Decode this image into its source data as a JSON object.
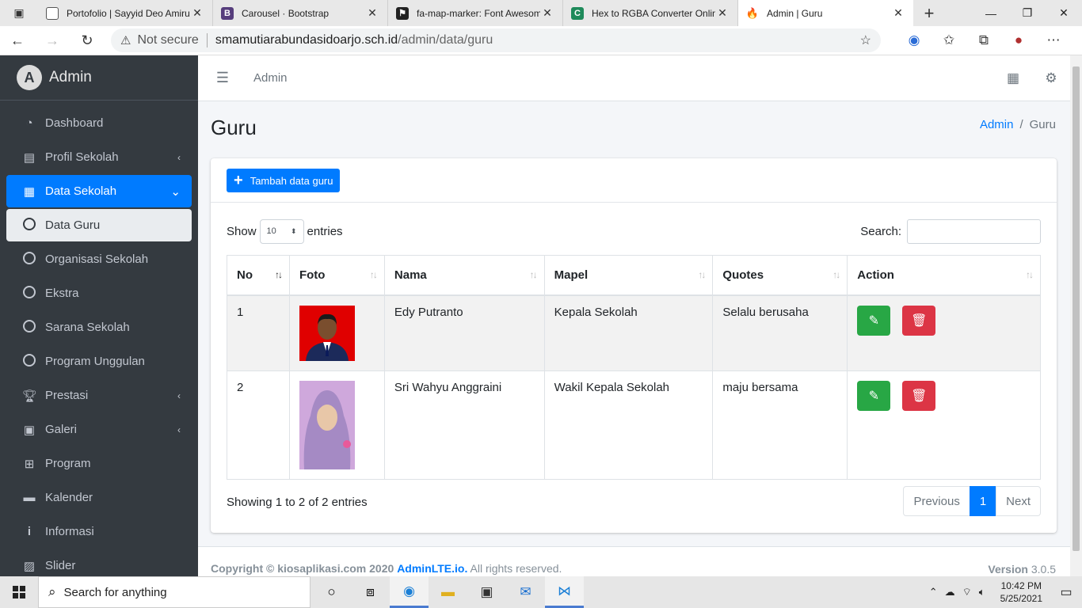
{
  "browser": {
    "tabs": [
      {
        "title": "Portofolio | Sayyid Deo Amiru",
        "favicon": "page-icon"
      },
      {
        "title": "Carousel · Bootstrap",
        "favicon": "bootstrap-icon"
      },
      {
        "title": "fa-map-marker: Font Awesom",
        "favicon": "flag-icon"
      },
      {
        "title": "Hex to RGBA Converter Onlin",
        "favicon": "c-icon"
      },
      {
        "title": "Admin | Guru",
        "favicon": "fire-icon"
      }
    ],
    "address": {
      "security": "Not secure",
      "host": "smamutiarabundasidoarjo.sch.id",
      "path": "/admin/data/guru"
    }
  },
  "sidebar": {
    "brand": "Admin",
    "items": [
      {
        "label": "Dashboard",
        "icon": "tachometer-icon"
      },
      {
        "label": "Profil Sekolah",
        "icon": "id-card-icon",
        "arrow": "‹"
      },
      {
        "label": "Data Sekolah",
        "icon": "table-icon",
        "arrow": "⌄"
      },
      {
        "label": "Data Guru",
        "icon": "circle-icon"
      },
      {
        "label": "Organisasi Sekolah",
        "icon": "circle-icon"
      },
      {
        "label": "Ekstra",
        "icon": "circle-icon"
      },
      {
        "label": "Sarana Sekolah",
        "icon": "circle-icon"
      },
      {
        "label": "Program Unggulan",
        "icon": "circle-icon"
      },
      {
        "label": "Prestasi",
        "icon": "trophy-icon",
        "arrow": "‹"
      },
      {
        "label": "Galeri",
        "icon": "image-icon",
        "arrow": "‹"
      },
      {
        "label": "Program",
        "icon": "calendar-plus-icon"
      },
      {
        "label": "Kalender",
        "icon": "calendar-icon"
      },
      {
        "label": "Informasi",
        "icon": "info-icon"
      },
      {
        "label": "Slider",
        "icon": "images-icon"
      }
    ]
  },
  "topnav": {
    "link": "Admin"
  },
  "page": {
    "title": "Guru",
    "breadcrumb": {
      "home": "Admin",
      "sep": "/",
      "current": "Guru"
    },
    "add_button": "Tambah data guru"
  },
  "datatable": {
    "show_label": "Show",
    "entries_label": "entries",
    "page_length": "10",
    "search_label": "Search:",
    "columns": [
      "No",
      "Foto",
      "Nama",
      "Mapel",
      "Quotes",
      "Action"
    ],
    "rows": [
      {
        "no": "1",
        "nama": "Edy Putranto",
        "mapel": "Kepala Sekolah",
        "quotes": "Selalu berusaha"
      },
      {
        "no": "2",
        "nama": "Sri Wahyu Anggraini",
        "mapel": "Wakil Kepala Sekolah",
        "quotes": "maju bersama"
      }
    ],
    "info": "Showing 1 to 2 of 2 entries",
    "pager": {
      "prev": "Previous",
      "current": "1",
      "next": "Next"
    }
  },
  "footer": {
    "copyright": "Copyright © kiosaplikasi.com 2020",
    "brand_link": "AdminLTE.io.",
    "rights": "All rights reserved.",
    "version_label": "Version",
    "version": "3.0.5"
  },
  "taskbar": {
    "search_placeholder": "Search for anything",
    "time": "10:42 PM",
    "date": "5/25/2021"
  },
  "colors": {
    "primary": "#007bff",
    "success": "#28a745",
    "danger": "#dc3545",
    "sidebar": "#343a40"
  }
}
